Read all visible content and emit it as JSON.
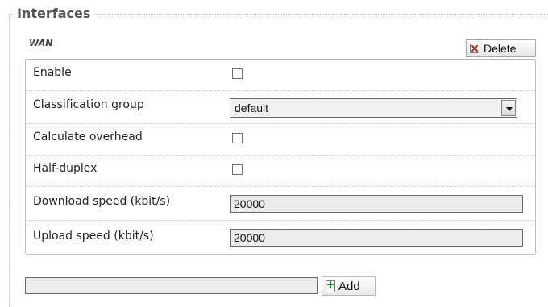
{
  "fieldset": {
    "legend": "Interfaces"
  },
  "section": {
    "title": "WAN",
    "delete_label": "Delete"
  },
  "rows": [
    {
      "label": "Enable",
      "type": "checkbox",
      "checked": false
    },
    {
      "label": "Classification group",
      "type": "select",
      "value": "default"
    },
    {
      "label": "Calculate overhead",
      "type": "checkbox",
      "checked": false
    },
    {
      "label": "Half-duplex",
      "type": "checkbox",
      "checked": false
    },
    {
      "label": "Download speed (kbit/s)",
      "type": "text",
      "value": "20000"
    },
    {
      "label": "Upload speed (kbit/s)",
      "type": "text",
      "value": "20000"
    }
  ],
  "add": {
    "input_value": "",
    "button_label": "Add"
  },
  "icons": {
    "delete": "delete-icon",
    "add": "add-icon"
  }
}
